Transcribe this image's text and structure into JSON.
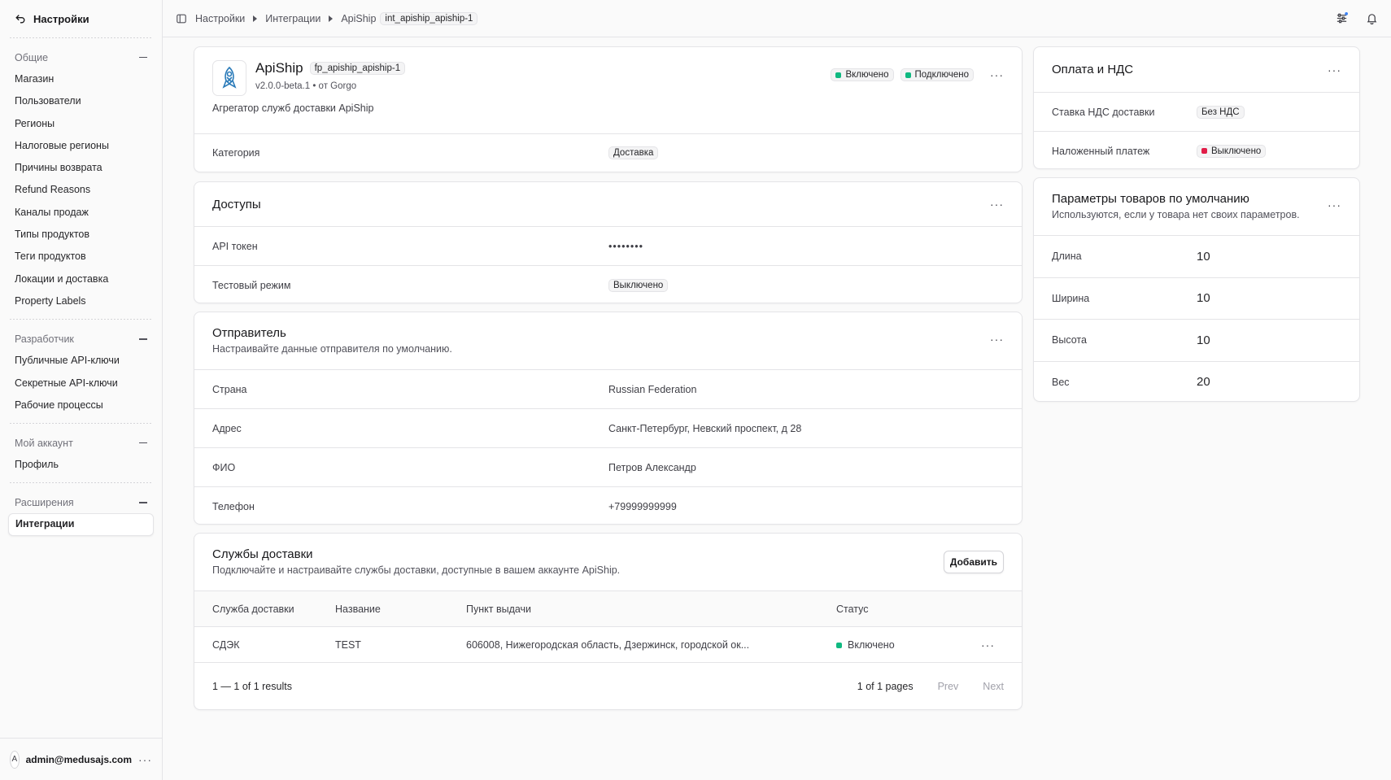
{
  "sidebar": {
    "title": "Настройки",
    "groups": [
      {
        "title": "Общие",
        "items": [
          "Магазин",
          "Пользователи",
          "Регионы",
          "Налоговые регионы",
          "Причины возврата",
          "Refund Reasons",
          "Каналы продаж",
          "Типы продуктов",
          "Теги продуктов",
          "Локации и доставка",
          "Property Labels"
        ]
      },
      {
        "title": "Разработчик",
        "items": [
          "Публичные API-ключи",
          "Секретные API-ключи",
          "Рабочие процессы"
        ]
      },
      {
        "title": "Мой аккаунт",
        "items": [
          "Профиль"
        ]
      },
      {
        "title": "Расширения",
        "items": [
          "Интеграции"
        ]
      }
    ],
    "user": {
      "initial": "A",
      "email": "admin@medusajs.com"
    }
  },
  "breadcrumb": {
    "items": [
      "Настройки",
      "Интеграции",
      "ApiShip"
    ],
    "code": "int_apiship_apiship-1"
  },
  "plugin": {
    "name": "ApiShip",
    "code": "fp_apiship_apiship-1",
    "version": "v2.0.0-beta.1 • от Gorgo",
    "description": "Агрегатор служб доставки ApiShip",
    "status_enabled": "Включено",
    "status_connected": "Подключено",
    "category_label": "Категория",
    "category_value": "Доставка"
  },
  "access": {
    "title": "Доступы",
    "rows": [
      {
        "label": "API токен",
        "value": "••••••••"
      },
      {
        "label": "Тестовый режим",
        "value": "Выключено"
      }
    ]
  },
  "sender": {
    "title": "Отправитель",
    "subtitle": "Настраивайте данные отправителя по умолчанию.",
    "rows": [
      {
        "label": "Страна",
        "value": "Russian Federation"
      },
      {
        "label": "Адрес",
        "value": "Санкт-Петербург, Невский проспект, д 28"
      },
      {
        "label": "ФИО",
        "value": "Петров Александр"
      },
      {
        "label": "Телефон",
        "value": "+79999999999"
      }
    ]
  },
  "services": {
    "title": "Службы доставки",
    "subtitle": "Подключайте и настраивайте службы доставки, доступные в вашем аккаунте ApiShip.",
    "add_label": "Добавить",
    "columns": [
      "Служба доставки",
      "Название",
      "Пункт выдачи",
      "Статус"
    ],
    "rows": [
      {
        "service": "СДЭК",
        "name": "TEST",
        "point": "606008, Нижегородская область, Дзержинск, городской ок...",
        "status": "Включено"
      }
    ],
    "results": "1 — 1 of 1 results",
    "pages": "1 of 1 pages",
    "prev": "Prev",
    "next": "Next"
  },
  "payment": {
    "title": "Оплата и НДС",
    "rows": [
      {
        "label": "Ставка НДС доставки",
        "value": "Без НДС"
      },
      {
        "label": "Наложенный платеж",
        "value": "Выключено"
      }
    ]
  },
  "defaults": {
    "title": "Параметры товаров по умолчанию",
    "subtitle": "Используются, если у товара нет своих параметров.",
    "rows": [
      {
        "label": "Длина",
        "value": "10"
      },
      {
        "label": "Ширина",
        "value": "10"
      },
      {
        "label": "Высота",
        "value": "10"
      },
      {
        "label": "Вес",
        "value": "20"
      }
    ]
  },
  "menu_dots": "···",
  "colors": {
    "enabled": "#10b981",
    "disabled": "#e11d48",
    "brand": "#2b7bb9"
  }
}
